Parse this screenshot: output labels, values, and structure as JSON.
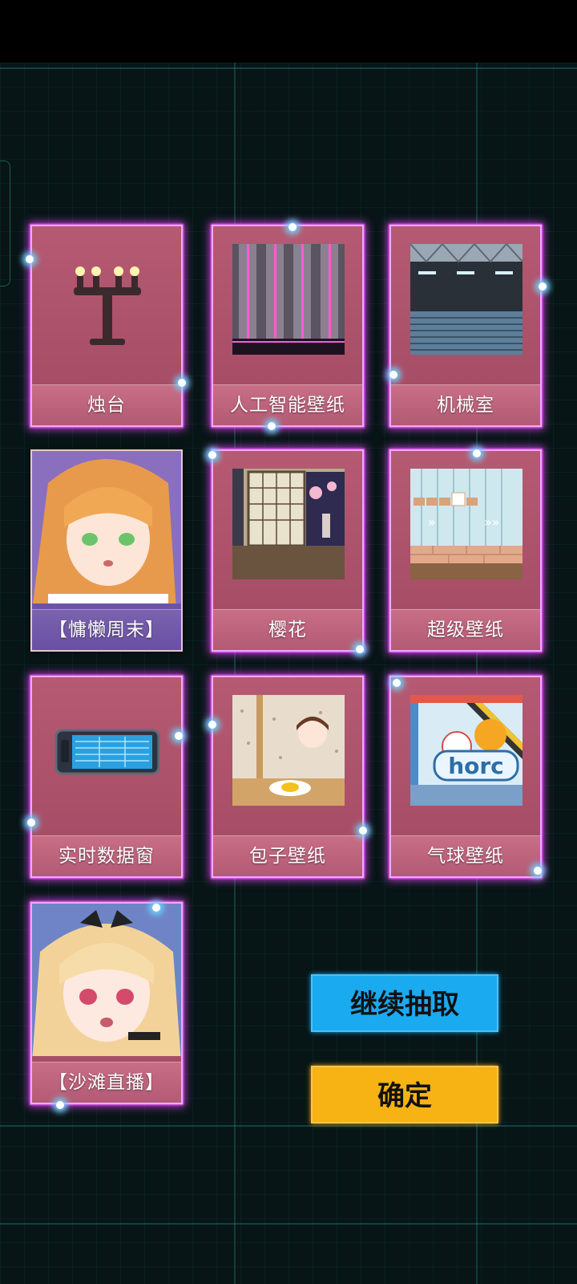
{
  "cards": [
    {
      "label": "烛台",
      "art": "candelabra"
    },
    {
      "label": "人工智能壁纸",
      "art": "neon-pillars"
    },
    {
      "label": "机械室",
      "art": "mechanical-room"
    },
    {
      "label": "【慵懒周末】",
      "art": "orange-hair-girl"
    },
    {
      "label": "樱花",
      "art": "japanese-room"
    },
    {
      "label": "超级壁纸",
      "art": "brick-room"
    },
    {
      "label": "实时数据窗",
      "art": "data-panel"
    },
    {
      "label": "包子壁纸",
      "art": "egg-room"
    },
    {
      "label": "气球壁纸",
      "art": "balloon-room"
    },
    {
      "label": "【沙滩直播】",
      "art": "blonde-girl"
    }
  ],
  "art_text": {
    "balloon_room": "horc"
  },
  "buttons": {
    "continue_label": "继续抽取",
    "confirm_label": "确定"
  },
  "colors": {
    "card_pink": "#b55a72",
    "card_purple": "#6b54a8",
    "glow": "#eb46ff",
    "continue_bg": "#1aaaf0",
    "confirm_bg": "#f7b214"
  }
}
